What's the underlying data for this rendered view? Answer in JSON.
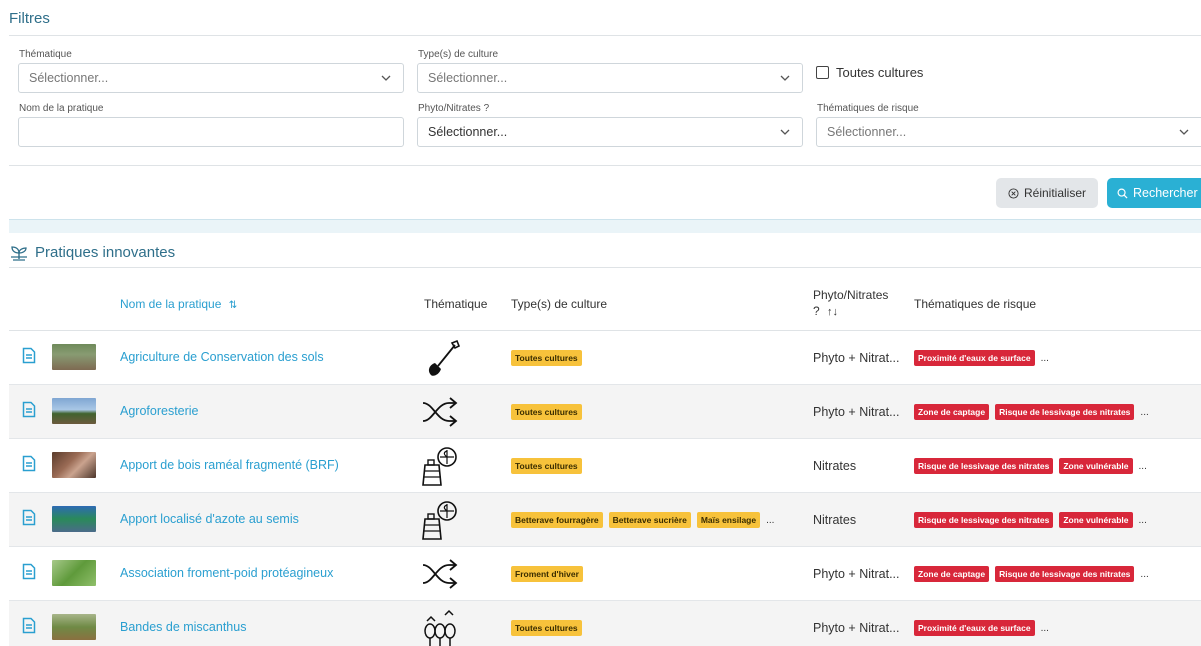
{
  "filters": {
    "title": "Filtres",
    "thematique": {
      "label": "Thématique",
      "placeholder": "Sélectionner..."
    },
    "culture": {
      "label": "Type(s) de culture",
      "placeholder": "Sélectionner..."
    },
    "toutes_cultures": "Toutes cultures",
    "nom": {
      "label": "Nom de la pratique",
      "value": ""
    },
    "phyto": {
      "label": "Phyto/Nitrates ?",
      "placeholder": "Sélectionner..."
    },
    "risque": {
      "label": "Thématiques de risque",
      "placeholder": "Sélectionner..."
    },
    "reset_label": "Réinitialiser",
    "search_label": "Rechercher"
  },
  "section": {
    "title": "Pratiques innovantes"
  },
  "table": {
    "headers": {
      "name": "Nom de la pratique",
      "theme": "Thématique",
      "culture": "Type(s) de culture",
      "phyto_line1": "Phyto/Nitrates",
      "phyto_line2": "?",
      "risk": "Thématiques de risque"
    },
    "rows": [
      {
        "name": "Agriculture de Conservation des sols",
        "theme_icon": "shovel-icon",
        "cultures": [
          "Toutes cultures"
        ],
        "cultures_more": "",
        "phyto": "Phyto + Nitrat...",
        "risks": [
          "Proximité d'eaux de surface"
        ],
        "risks_more": "..."
      },
      {
        "name": "Agroforesterie",
        "theme_icon": "shuffle-icon",
        "cultures": [
          "Toutes cultures"
        ],
        "cultures_more": "",
        "phyto": "Phyto + Nitrat...",
        "risks": [
          "Zone de captage",
          "Risque de lessivage des nitrates"
        ],
        "risks_more": "..."
      },
      {
        "name": "Apport de bois raméal fragmenté (BRF)",
        "theme_icon": "fertilizer-bag-icon",
        "cultures": [
          "Toutes cultures"
        ],
        "cultures_more": "",
        "phyto": "Nitrates",
        "risks": [
          "Risque de lessivage des nitrates",
          "Zone vulnérable"
        ],
        "risks_more": "..."
      },
      {
        "name": "Apport localisé d'azote au semis",
        "theme_icon": "fertilizer-bag-icon",
        "cultures": [
          "Betterave fourragère",
          "Betterave sucrière",
          "Maïs ensilage"
        ],
        "cultures_more": "...",
        "phyto": "Nitrates",
        "risks": [
          "Risque de lessivage des nitrates",
          "Zone vulnérable"
        ],
        "risks_more": "..."
      },
      {
        "name": "Association froment-poid protéagineux",
        "theme_icon": "shuffle-icon",
        "cultures": [
          "Froment d'hiver"
        ],
        "cultures_more": "",
        "phyto": "Phyto + Nitrat...",
        "risks": [
          "Zone de captage",
          "Risque de lessivage des nitrates"
        ],
        "risks_more": "..."
      },
      {
        "name": "Bandes de miscanthus",
        "theme_icon": "trees-icon",
        "cultures": [
          "Toutes cultures"
        ],
        "cultures_more": "",
        "phyto": "Phyto + Nitrat...",
        "risks": [
          "Proximité d'eaux de surface"
        ],
        "risks_more": "..."
      }
    ]
  }
}
